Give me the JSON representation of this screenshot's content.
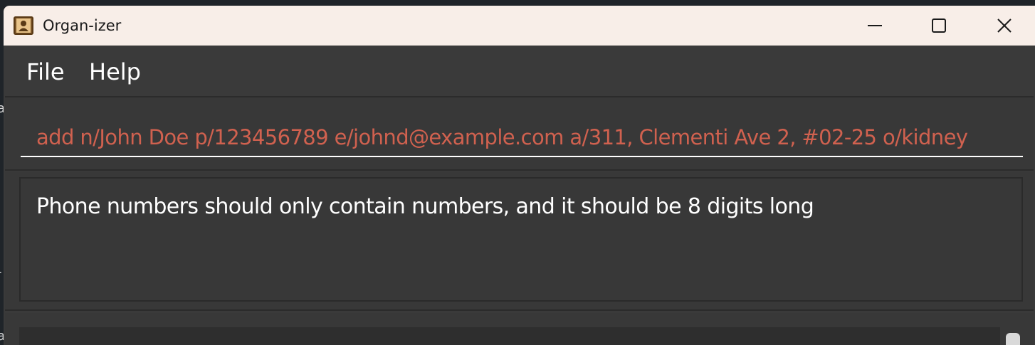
{
  "window": {
    "title": "Organ-izer"
  },
  "menu": {
    "items": [
      "File",
      "Help"
    ]
  },
  "command": {
    "value": "add n/John Doe p/123456789 e/johnd@example.com a/311, Clementi Ave 2, #02-25 o/kidney"
  },
  "result": {
    "message": "Phone numbers should only contain numbers, and it should be 8 digits long"
  },
  "colors": {
    "titlebar": "#f8eee8",
    "background": "#3a3a3a",
    "command_text": "#d0614f",
    "result_text": "#ffffff"
  },
  "icons": {
    "app": "contact-book-icon",
    "minimize": "minimize-icon",
    "maximize": "maximize-icon",
    "close": "close-icon"
  }
}
